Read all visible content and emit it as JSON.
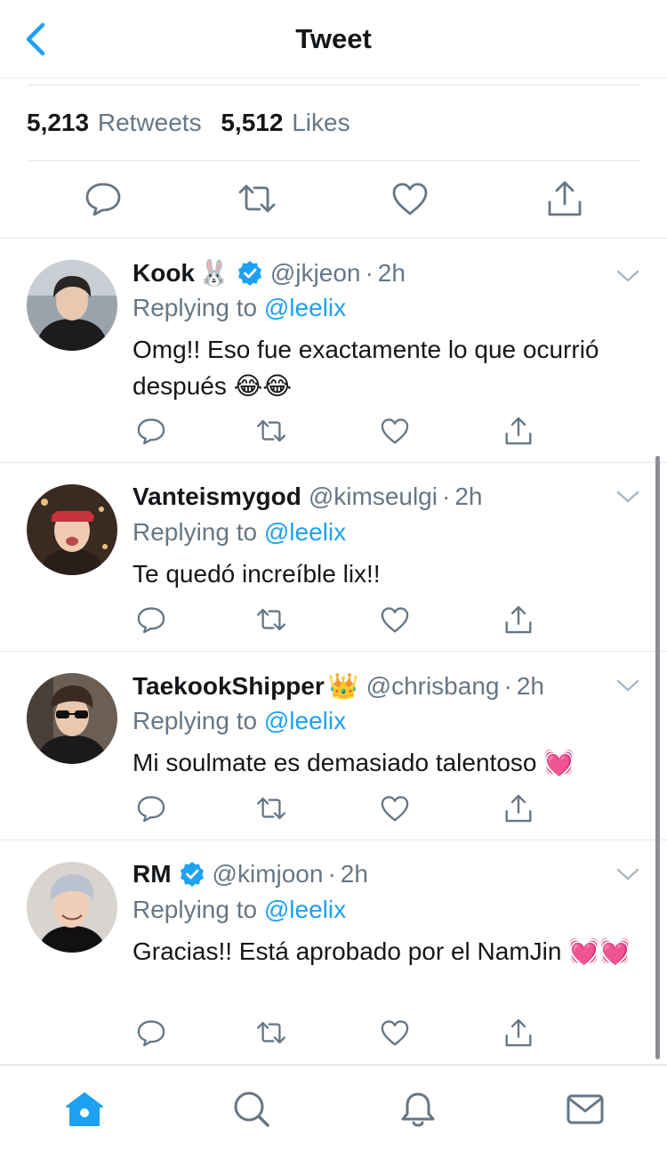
{
  "header": {
    "title": "Tweet"
  },
  "stats": {
    "retweets_count": "5,213",
    "retweets_label": "Retweets",
    "likes_count": "5,512",
    "likes_label": "Likes"
  },
  "colors": {
    "accent": "#1da1f2",
    "muted": "#657786",
    "text": "#14171a",
    "divider": "#e1e8ed"
  },
  "replies": [
    {
      "display_name": "Kook",
      "name_emoji": "🐰",
      "verified": true,
      "handle": "@jkjeon",
      "dot": "·",
      "time": "2h",
      "replying_prefix": "Replying to",
      "replying_to": "@leelix",
      "text": "Omg!! Eso fue exactamente lo que ocurrió después 😂😂"
    },
    {
      "display_name": "Vanteismygod",
      "name_emoji": "",
      "verified": false,
      "handle": "@kimseulgi",
      "dot": "·",
      "time": "2h",
      "replying_prefix": "Replying to",
      "replying_to": "@leelix",
      "text": "Te quedó increíble lix!!"
    },
    {
      "display_name": "TaekookShipper",
      "name_emoji": "👑",
      "verified": false,
      "handle": "@chrisbang",
      "dot": "·",
      "time": "2h",
      "replying_prefix": "Replying to",
      "replying_to": "@leelix",
      "text": "Mi soulmate es demasiado talentoso 💓"
    },
    {
      "display_name": "RM",
      "name_emoji": "",
      "verified": true,
      "handle": "@kimjoon",
      "dot": "·",
      "time": "2h",
      "replying_prefix": "Replying to",
      "replying_to": "@leelix",
      "text": "Gracias!! Está aprobado por el NamJin 💓💓"
    }
  ],
  "icons": {
    "back": "chevron-left-icon",
    "reply": "speech-bubble-icon",
    "retweet": "retweet-icon",
    "like": "heart-icon",
    "share": "share-icon",
    "more": "chevron-down-icon",
    "home": "home-icon",
    "search": "search-icon",
    "notifications": "bell-icon",
    "messages": "envelope-icon"
  }
}
